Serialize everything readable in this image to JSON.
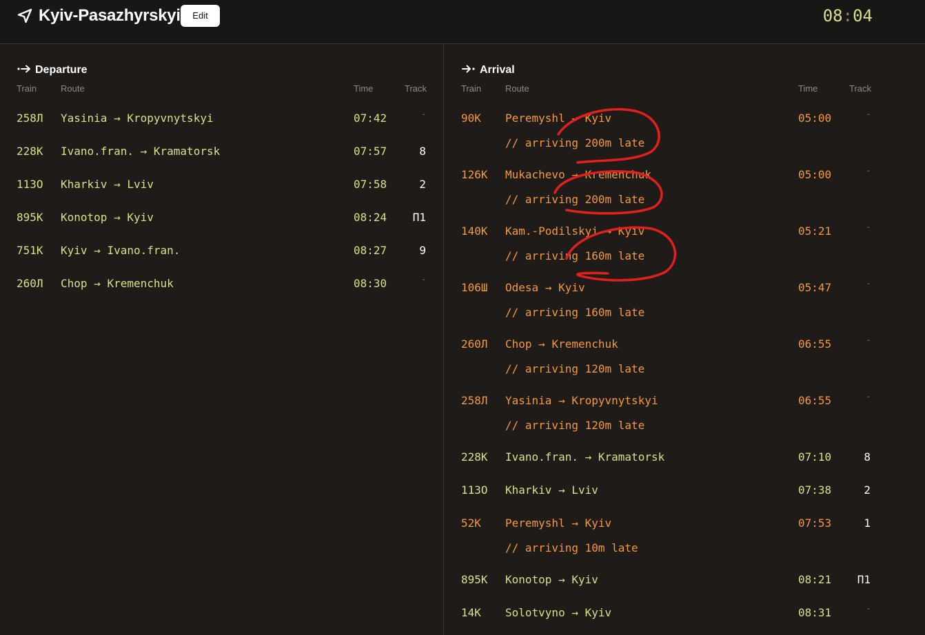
{
  "header": {
    "station_name": "Kyiv-Pasazhyrskyi",
    "edit_label": "Edit",
    "clock_hours": "08",
    "clock_separator": ":",
    "clock_minutes": "04"
  },
  "departure": {
    "title": "Departure",
    "columns": {
      "train": "Train",
      "route": "Route",
      "time": "Time",
      "track": "Track"
    },
    "rows": [
      {
        "train": "258Л",
        "from": "Yasinia",
        "arrow": "→",
        "to": "Kropyvnytskyi",
        "time": "07:42",
        "track": "-"
      },
      {
        "train": "228К",
        "from": "Ivano.fran.",
        "arrow": "→",
        "to": "Kramatorsk",
        "time": "07:57",
        "track": "8"
      },
      {
        "train": "113О",
        "from": "Kharkiv",
        "arrow": "→",
        "to": "Lviv",
        "time": "07:58",
        "track": "2"
      },
      {
        "train": "895К",
        "from": "Konotop",
        "arrow": "→",
        "to": "Kyiv",
        "time": "08:24",
        "track": "П1"
      },
      {
        "train": "751К",
        "from": "Kyiv",
        "arrow": "→",
        "to": "Ivano.fran.",
        "time": "08:27",
        "track": "9"
      },
      {
        "train": "260Л",
        "from": "Chop",
        "arrow": "→",
        "to": "Kremenchuk",
        "time": "08:30",
        "track": "-"
      }
    ]
  },
  "arrival": {
    "title": "Arrival",
    "columns": {
      "train": "Train",
      "route": "Route",
      "time": "Time",
      "track": "Track"
    },
    "rows": [
      {
        "train": "90К",
        "from": "Peremyshl",
        "arrow": "→",
        "to": "Kyiv",
        "time": "05:00",
        "track": "-",
        "late": "// arriving 200m late"
      },
      {
        "train": "126К",
        "from": "Mukachevo",
        "arrow": "→",
        "to": "Kremenchuk",
        "time": "05:00",
        "track": "-",
        "late": "// arriving 200m late"
      },
      {
        "train": "140К",
        "from": "Kam.-Podilskyi",
        "arrow": "→",
        "to": "Kyiv",
        "time": "05:21",
        "track": "-",
        "late": "// arriving 160m late"
      },
      {
        "train": "106Ш",
        "from": "Odesa",
        "arrow": "→",
        "to": "Kyiv",
        "time": "05:47",
        "track": "-",
        "late": "// arriving 160m late"
      },
      {
        "train": "260Л",
        "from": "Chop",
        "arrow": "→",
        "to": "Kremenchuk",
        "time": "06:55",
        "track": "-",
        "late": "// arriving 120m late"
      },
      {
        "train": "258Л",
        "from": "Yasinia",
        "arrow": "→",
        "to": "Kropyvnytskyi",
        "time": "06:55",
        "track": "-",
        "late": "// arriving 120m late"
      },
      {
        "train": "228К",
        "from": "Ivano.fran.",
        "arrow": "→",
        "to": "Kramatorsk",
        "time": "07:10",
        "track": "8"
      },
      {
        "train": "113О",
        "from": "Kharkiv",
        "arrow": "→",
        "to": "Lviv",
        "time": "07:38",
        "track": "2"
      },
      {
        "train": "52К",
        "from": "Peremyshl",
        "arrow": "→",
        "to": "Kyiv",
        "time": "07:53",
        "track": "1",
        "late": "// arriving 10m late"
      },
      {
        "train": "895К",
        "from": "Konotop",
        "arrow": "→",
        "to": "Kyiv",
        "time": "08:21",
        "track": "П1"
      },
      {
        "train": "14К",
        "from": "Solotvyno",
        "arrow": "→",
        "to": "Kyiv",
        "time": "08:31",
        "track": "-"
      }
    ]
  },
  "colors": {
    "background": "#1e1b19",
    "header_background": "#191715",
    "on_time_yellow": "#d9e08a",
    "delayed_orange": "#f39a3c",
    "muted_gray": "#8e8a85",
    "annotation_red": "#e0201e"
  },
  "icons": {
    "station": "navigation-arrow-icon",
    "departure": "departure-arrow-icon",
    "arrival": "arrival-arrow-icon"
  }
}
